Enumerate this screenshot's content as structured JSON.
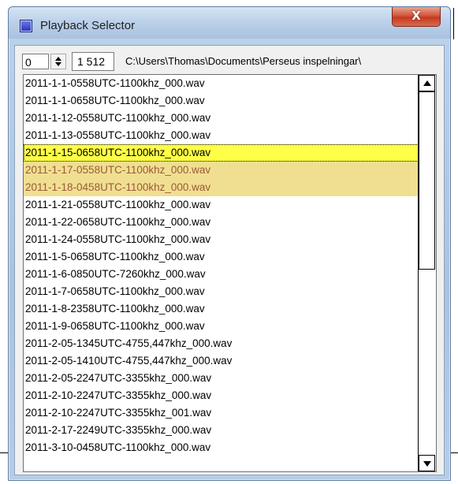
{
  "window": {
    "title": "Playback Selector",
    "close_symbol": "X",
    "icon": "app-icon"
  },
  "controls": {
    "index_value": "0",
    "count_value": "1 512",
    "folder_path": "C:\\Users\\Thomas\\Documents\\Perseus inspelningar\\"
  },
  "files": [
    {
      "name": "2011-1-1-0558UTC-1100khz_000.wav",
      "state": ""
    },
    {
      "name": "2011-1-1-0658UTC-1100khz_000.wav",
      "state": ""
    },
    {
      "name": "2011-1-12-0558UTC-1100khz_000.wav",
      "state": ""
    },
    {
      "name": "2011-1-13-0558UTC-1100khz_000.wav",
      "state": ""
    },
    {
      "name": "2011-1-15-0658UTC-1100khz_000.wav",
      "state": "focused"
    },
    {
      "name": "2011-1-17-0558UTC-1100khz_000.wav",
      "state": "selected"
    },
    {
      "name": "2011-1-18-0458UTC-1100khz_000.wav",
      "state": "selected"
    },
    {
      "name": "2011-1-21-0558UTC-1100khz_000.wav",
      "state": ""
    },
    {
      "name": "2011-1-22-0658UTC-1100khz_000.wav",
      "state": ""
    },
    {
      "name": "2011-1-24-0558UTC-1100khz_000.wav",
      "state": ""
    },
    {
      "name": "2011-1-5-0658UTC-1100khz_000.wav",
      "state": ""
    },
    {
      "name": "2011-1-6-0850UTC-7260khz_000.wav",
      "state": ""
    },
    {
      "name": "2011-1-7-0658UTC-1100khz_000.wav",
      "state": ""
    },
    {
      "name": "2011-1-8-2358UTC-1100khz_000.wav",
      "state": ""
    },
    {
      "name": "2011-1-9-0658UTC-1100khz_000.wav",
      "state": ""
    },
    {
      "name": "2011-2-05-1345UTC-4755,447khz_000.wav",
      "state": ""
    },
    {
      "name": "2011-2-05-1410UTC-4755,447khz_000.wav",
      "state": ""
    },
    {
      "name": "2011-2-05-2247UTC-3355khz_000.wav",
      "state": ""
    },
    {
      "name": "2011-2-10-2247UTC-3355khz_000.wav",
      "state": ""
    },
    {
      "name": "2011-2-10-2247UTC-3355khz_001.wav",
      "state": ""
    },
    {
      "name": "2011-2-17-2249UTC-3355khz_000.wav",
      "state": ""
    },
    {
      "name": "2011-3-10-0458UTC-1100khz_000.wav",
      "state": ""
    }
  ],
  "colors": {
    "focused_row": "#ffff47",
    "selected_row": "#f0df91",
    "selected_text": "#9b5a3a"
  }
}
